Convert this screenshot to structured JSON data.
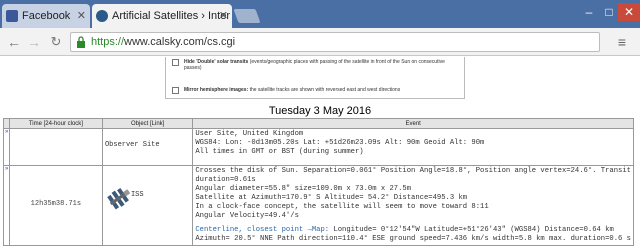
{
  "browser": {
    "tabs": [
      {
        "label": "Facebook",
        "active": false
      },
      {
        "label": "Artificial Satellites › Inter",
        "active": true
      }
    ],
    "url": {
      "scheme": "https://",
      "rest": "www.calsky.com/cs.cgi"
    },
    "window_controls": {
      "minimize": "–",
      "maximize": "□",
      "close": "✕"
    }
  },
  "options": {
    "hide_double_solar": {
      "label": "Hide 'Double' solar transits",
      "text": " (events/geographic places with passing of the satellite in front of the Sun on consecutive passes)"
    },
    "mirror_hemisphere": {
      "label": "Mirror hemisphere images:",
      "text": " the satellite tracks are shown with reversed east and west directions"
    }
  },
  "date_heading": "Tuesday 3 May 2016",
  "table": {
    "headers": {
      "time": "Time [24-hour clock]",
      "object": "Object [Link]",
      "event": "Event"
    },
    "observer_row": {
      "marker": "»",
      "object": "Observer Site",
      "lines": [
        "User Site, United Kingdom",
        "WGS84: Lon:    -0d13m05.20s  Lat: +51d26m23.09s  Alt: 90m  Geoid Alt: 90m",
        "All times in GMT or BST (during summer)"
      ]
    },
    "iss_row": {
      "marker": "»",
      "time": "12h35m38.71s",
      "object": "ISS",
      "lines": [
        "Crosses the disk of Sun. Separation=0.061°  Position Angle=18.8°, Position angle vertex=24.6°.  Transit",
        "duration=0.61s",
        "Angular diameter=55.8\"  size=109.0m x 73.0m x 27.5m",
        "Satellite at Azimuth=170.9° S    Altitude= 54.2°  Distance=495.3 km",
        "In a clock-face concept, the satellite will seem to move toward  8:11",
        "Angular Velocity=49.4'/s"
      ],
      "centerline": {
        "prefix": "Centerline, closest point ",
        "map_link": "→Map:",
        "rest": " Longitude=   0°12'54\"W  Latitude=+51°26'43\" (WGS84)  Distance=0.64 km",
        "line2": " Azimuth= 20.5° NNE  Path direction=110.4° ESE  ground speed=7.436 km/s  width=5.8 km  max. duration=0.6 s"
      }
    }
  }
}
